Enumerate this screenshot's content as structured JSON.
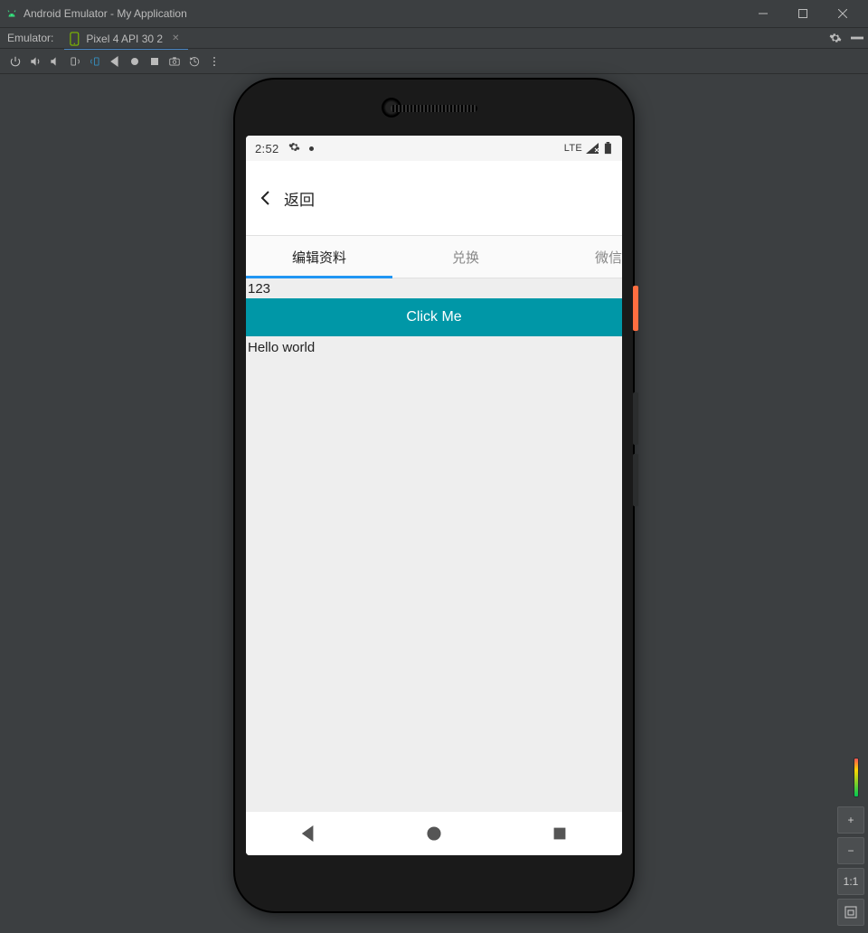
{
  "window": {
    "title": "Android Emulator - My Application"
  },
  "devicebar": {
    "label": "Emulator:",
    "tab_name": "Pixel 4 API 30 2"
  },
  "statusbar": {
    "time": "2:52",
    "network": "LTE"
  },
  "appbar": {
    "back_label": "返回"
  },
  "tabs": [
    {
      "label": "编辑资料",
      "active": true
    },
    {
      "label": "兑换",
      "active": false
    },
    {
      "label": "微信",
      "active": false
    }
  ],
  "content": {
    "line1": "123",
    "button_label": "Click Me",
    "line2": "Hello world"
  },
  "zoom": {
    "plus": "+",
    "minus": "−",
    "one_to_one": "1:1"
  }
}
